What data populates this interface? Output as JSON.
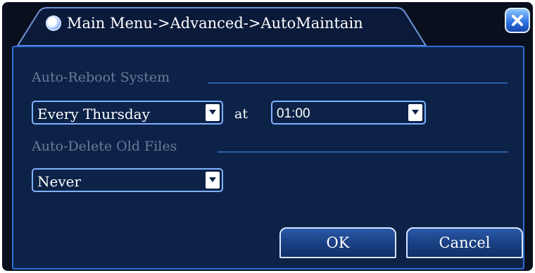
{
  "window": {
    "title": "Main Menu->Advanced->AutoMaintain"
  },
  "auto_reboot": {
    "section_label": "Auto-Reboot System",
    "frequency_value": "Every Thursday",
    "at_label": "at",
    "time_value": "01:00"
  },
  "auto_delete": {
    "section_label": "Auto-Delete Old Files",
    "value": "Never"
  },
  "buttons": {
    "ok_label": "OK",
    "cancel_label": "Cancel"
  },
  "colors": {
    "panel_background": "#0c2247",
    "panel_border": "#2f6fd8",
    "window_background": "#0a0f1d",
    "section_label": "#6a7b99",
    "text": "#ffffff",
    "select_border": "#7fb2ff"
  },
  "icons": {
    "title": "camera-lens-icon",
    "close": "close-icon",
    "dropdown": "chevron-down-icon"
  }
}
